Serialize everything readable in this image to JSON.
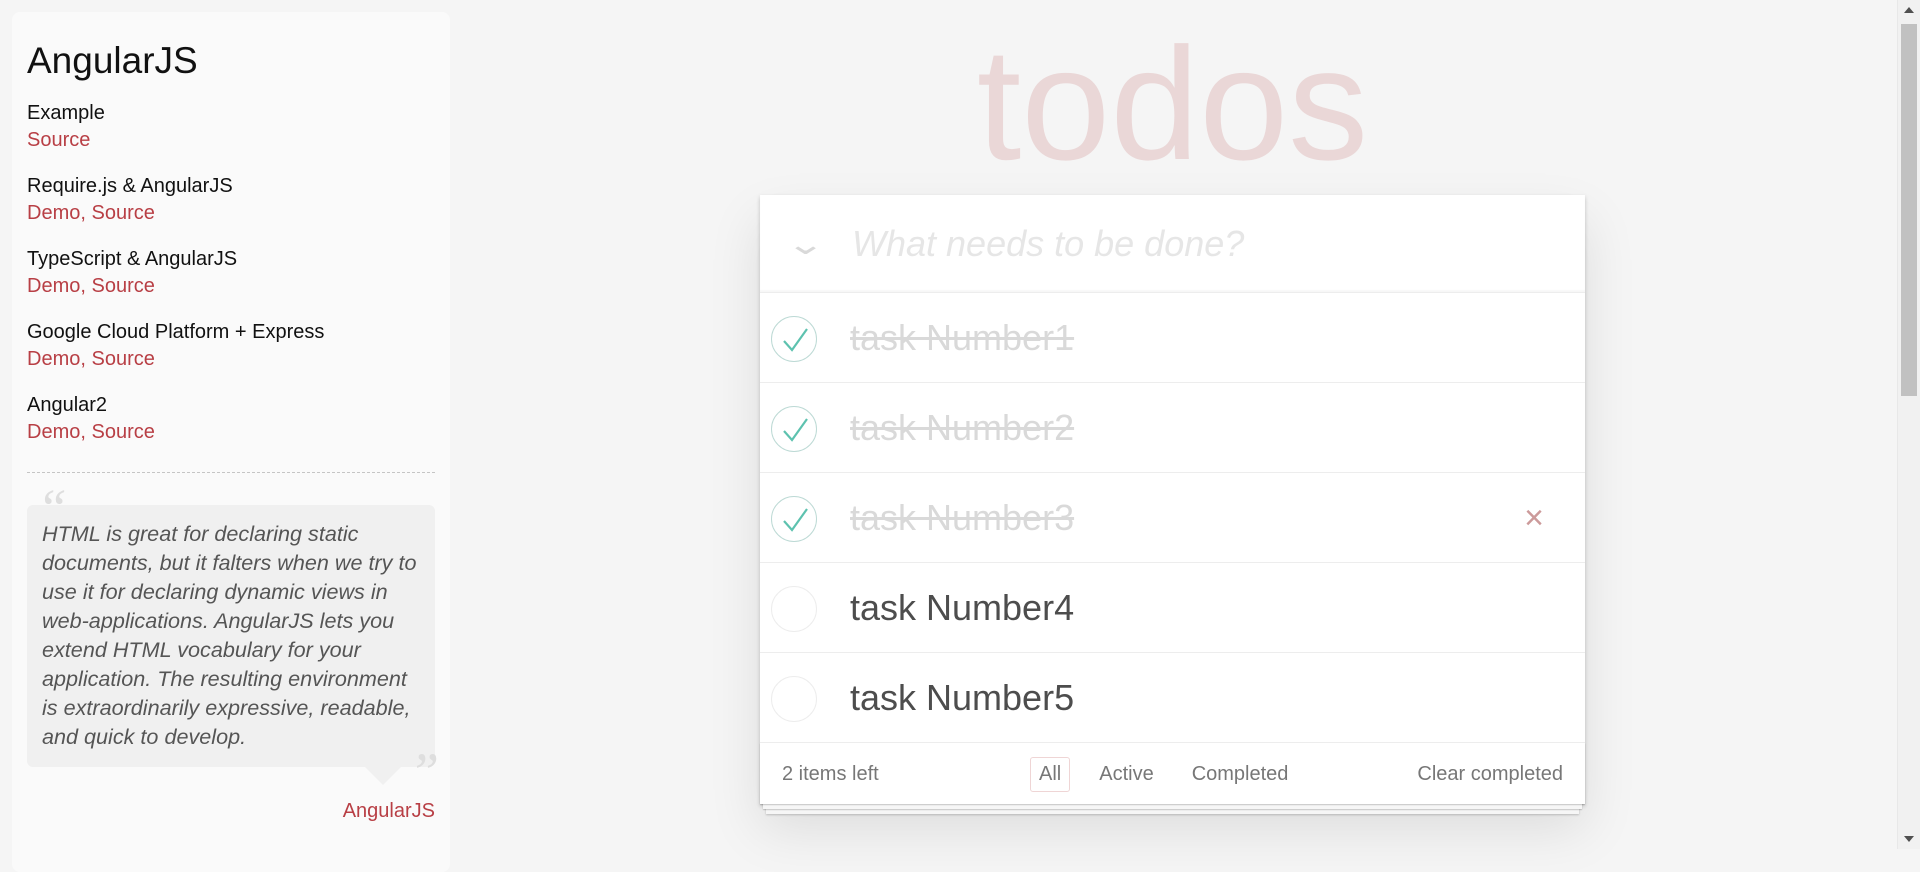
{
  "sidebar": {
    "title": "AngularJS",
    "items": [
      {
        "title": "Example",
        "links": [
          "Source"
        ]
      },
      {
        "title": "Require.js & AngularJS",
        "links": [
          "Demo",
          "Source"
        ]
      },
      {
        "title": "TypeScript & AngularJS",
        "links": [
          "Demo",
          "Source"
        ]
      },
      {
        "title": "Google Cloud Platform + Express",
        "links": [
          "Demo",
          "Source"
        ]
      },
      {
        "title": "Angular2",
        "links": [
          "Demo",
          "Source"
        ]
      }
    ],
    "quote": {
      "text": "HTML is great for declaring static documents, but it falters when we try to use it for declaring dynamic views in web-applications. AngularJS lets you extend HTML vocabulary for your application. The resulting environment is extraordinarily expressive, readable, and quick to develop.",
      "credit": "AngularJS"
    }
  },
  "app": {
    "title": "todos",
    "new_todo_placeholder": "What needs to be done?",
    "toggle_all_icon": "chevron-down-icon",
    "todos": [
      {
        "label": "task Number1",
        "completed": true
      },
      {
        "label": "task Number2",
        "completed": true
      },
      {
        "label": "task Number3",
        "completed": true,
        "hovered": true
      },
      {
        "label": "task Number4",
        "completed": false
      },
      {
        "label": "task Number5",
        "completed": false
      }
    ],
    "footer": {
      "count": "2 items left",
      "filters": [
        "All",
        "Active",
        "Completed"
      ],
      "selected_filter": "All",
      "clear_completed": "Clear completed"
    }
  },
  "colors": {
    "accent": "#b83f45",
    "title": "rgba(175,47,47,0.15)",
    "check": "#5dc2af",
    "destroy": "#cc9a9a"
  }
}
